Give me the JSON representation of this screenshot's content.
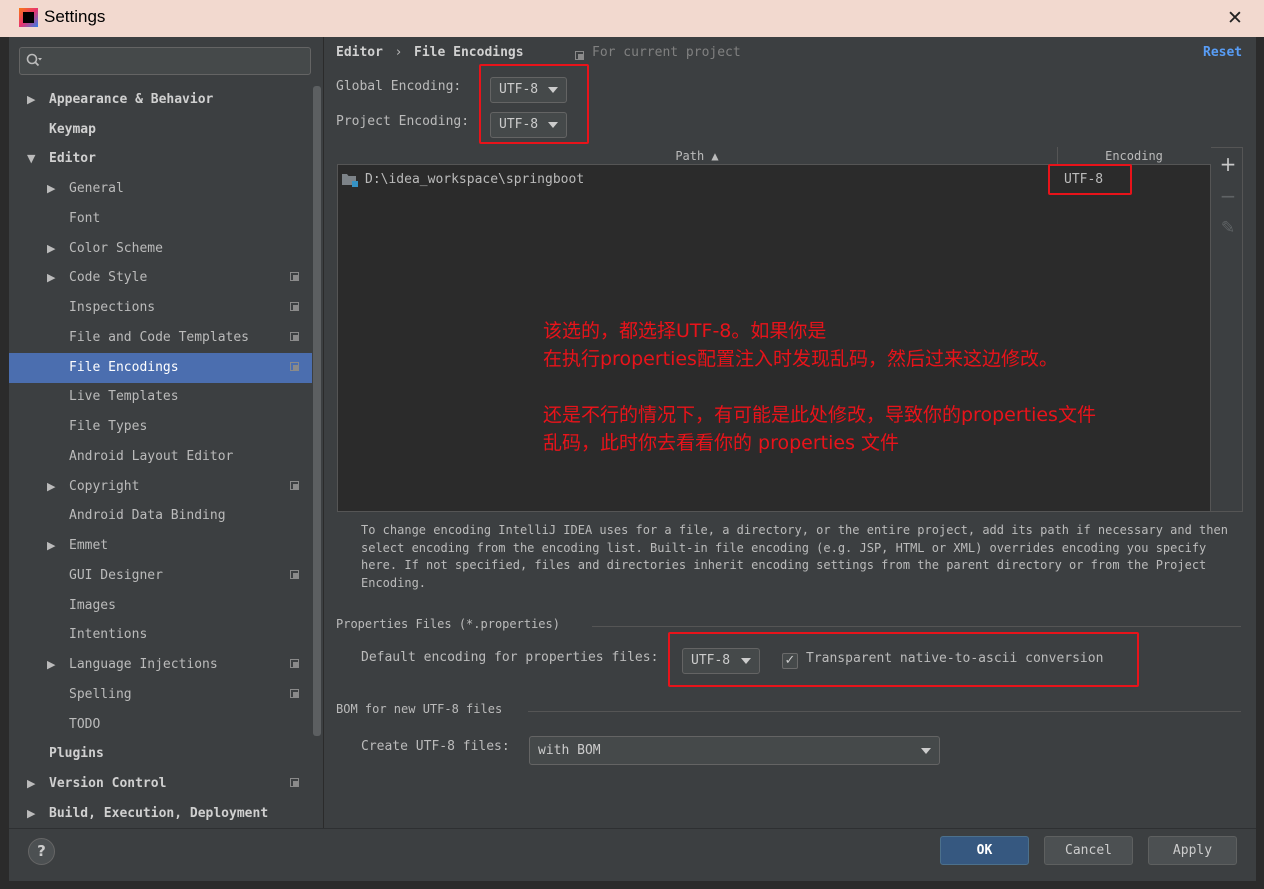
{
  "window": {
    "title": "Settings",
    "close_glyph": "✕"
  },
  "sidebar": {
    "search_placeholder": "",
    "items": [
      {
        "label": "Appearance & Behavior",
        "arrow": "▶"
      },
      {
        "label": "Keymap",
        "arrow": ""
      },
      {
        "label": "Editor",
        "arrow": "▼"
      },
      {
        "label": "General",
        "arrow": "▶"
      },
      {
        "label": "Font",
        "arrow": ""
      },
      {
        "label": "Color Scheme",
        "arrow": "▶"
      },
      {
        "label": "Code Style",
        "arrow": "▶"
      },
      {
        "label": "Inspections",
        "arrow": ""
      },
      {
        "label": "File and Code Templates",
        "arrow": ""
      },
      {
        "label": "File Encodings",
        "arrow": ""
      },
      {
        "label": "Live Templates",
        "arrow": ""
      },
      {
        "label": "File Types",
        "arrow": ""
      },
      {
        "label": "Android Layout Editor",
        "arrow": ""
      },
      {
        "label": "Copyright",
        "arrow": "▶"
      },
      {
        "label": "Android Data Binding",
        "arrow": ""
      },
      {
        "label": "Emmet",
        "arrow": "▶"
      },
      {
        "label": "GUI Designer",
        "arrow": ""
      },
      {
        "label": "Images",
        "arrow": ""
      },
      {
        "label": "Intentions",
        "arrow": ""
      },
      {
        "label": "Language Injections",
        "arrow": "▶"
      },
      {
        "label": "Spelling",
        "arrow": ""
      },
      {
        "label": "TODO",
        "arrow": ""
      },
      {
        "label": "Plugins",
        "arrow": ""
      },
      {
        "label": "Version Control",
        "arrow": "▶"
      },
      {
        "label": "Build, Execution, Deployment",
        "arrow": "▶"
      }
    ]
  },
  "breadcrumb": {
    "parent": "Editor",
    "separator": "›",
    "current": "File Encodings",
    "scope": "For current project",
    "reset": "Reset"
  },
  "global_encoding": {
    "label": "Global Encoding:",
    "value": "UTF-8"
  },
  "project_encoding": {
    "label": "Project Encoding:",
    "value": "UTF-8"
  },
  "table": {
    "col_path": "Path ▲",
    "col_encoding": "Encoding",
    "rows": [
      {
        "path": "D:\\idea_workspace\\springboot",
        "encoding": "UTF-8"
      }
    ],
    "add_glyph": "+",
    "remove_glyph": "−",
    "edit_glyph": "✎"
  },
  "annotation": "该选的，都选择UTF-8。如果你是\n在执行properties配置注入时发现乱码，然后过来这边修改。\n\n还是不行的情况下，有可能是此处修改，导致你的properties文件\n乱码，此时你去看看你的 properties 文件",
  "help_text": "To change encoding IntelliJ IDEA uses for a file, a directory, or the entire project, add its path if necessary and then select encoding from the encoding list. Built-in file encoding (e.g. JSP, HTML or XML) overrides encoding you specify here. If not specified, files and directories inherit encoding settings from the parent directory or from the Project Encoding.",
  "properties": {
    "section_title": "Properties Files (*.properties)",
    "default_label": "Default encoding for properties files:",
    "default_value": "UTF-8",
    "transparent_label": "Transparent native-to-ascii conversion",
    "transparent_checked": true,
    "check_glyph": "✓"
  },
  "bom": {
    "section_title": "BOM for new UTF-8 files",
    "create_label": "Create UTF-8 files:",
    "create_value": "with BOM"
  },
  "buttons": {
    "ok": "OK",
    "cancel": "Cancel",
    "apply": "Apply",
    "help": "?"
  },
  "colors": {
    "accent": "#4b6eaf",
    "annotation": "#e8131a",
    "background": "#3c3f41",
    "primary_button": "#365880"
  }
}
